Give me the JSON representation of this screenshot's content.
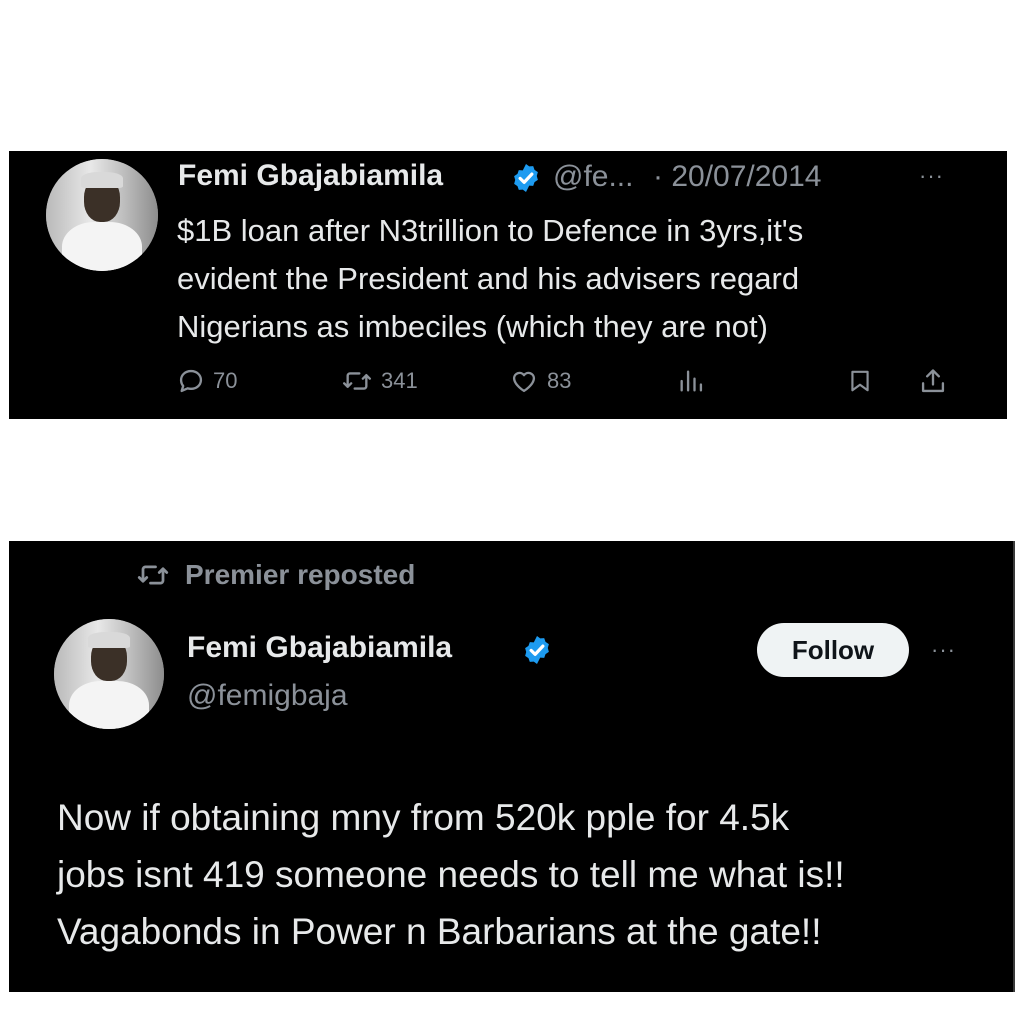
{
  "tweet1": {
    "name": "Femi Gbajabiamila",
    "handle": "@fe...",
    "date": "· 20/07/2014",
    "more": "···",
    "text_lines": [
      "$1B loan after N3trillion to Defence in 3yrs,it's",
      "evident the President and his advisers regard",
      "Nigerians as imbeciles (which they are not)"
    ],
    "stats": {
      "replies": "70",
      "reposts": "341",
      "likes": "83"
    }
  },
  "tweet2": {
    "repost_label": "Premier reposted",
    "name": "Femi Gbajabiamila",
    "handle": "@femigbaja",
    "follow_label": "Follow",
    "more": "···",
    "text_lines": [
      "Now if obtaining mny from 520k pple for 4.5k",
      "jobs isnt 419  someone needs to tell me what is!!",
      "Vagabonds in Power n Barbarians at the gate!!"
    ]
  },
  "colors": {
    "background": "#000000",
    "text": "#e7e9ea",
    "muted": "#8b9199",
    "verified": "#1d9bf0",
    "button": "#eff3f4"
  }
}
